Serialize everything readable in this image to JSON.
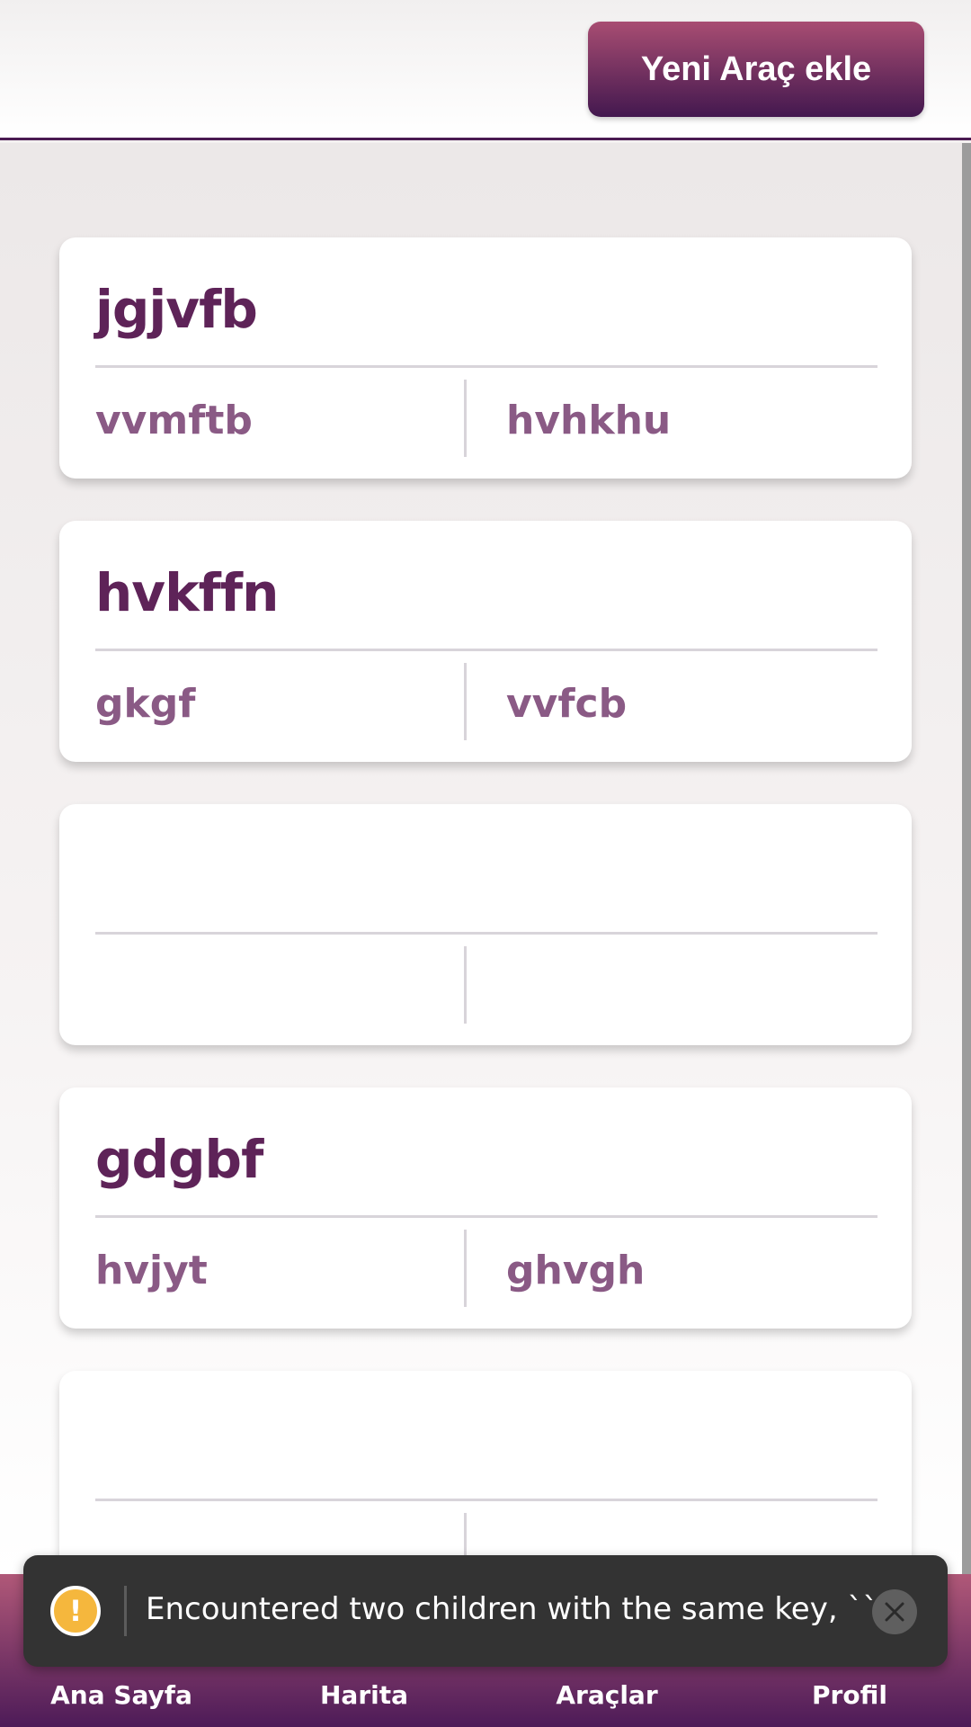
{
  "header": {
    "add_button_label": "Yeni Araç ekle"
  },
  "cards": [
    {
      "title": "jgjvfb",
      "left": "vvmftb",
      "right": "hvhkhu"
    },
    {
      "title": "hvkffn",
      "left": "gkgf",
      "right": "vvfcb"
    },
    {
      "title": "",
      "left": "",
      "right": ""
    },
    {
      "title": "gdgbf",
      "left": "hvjyt",
      "right": "ghvgh"
    },
    {
      "title": "",
      "left": "",
      "right": ""
    }
  ],
  "bottom_nav": [
    {
      "label": "Ana Sayfa",
      "icon": "home-icon"
    },
    {
      "label": "Harita",
      "icon": "map-icon"
    },
    {
      "label": "Araçlar",
      "icon": "car-icon"
    },
    {
      "label": "Profil",
      "icon": "profile-icon"
    }
  ],
  "toast": {
    "message": "Encountered two children with the same key, ``....",
    "icon": "warning-icon",
    "close_icon": "close-icon"
  },
  "colors": {
    "accent_top": "#a84d72",
    "accent_bottom": "#43184f",
    "title_text": "#5e2358",
    "detail_text": "#8a5a85",
    "warning": "#f5b73d"
  }
}
